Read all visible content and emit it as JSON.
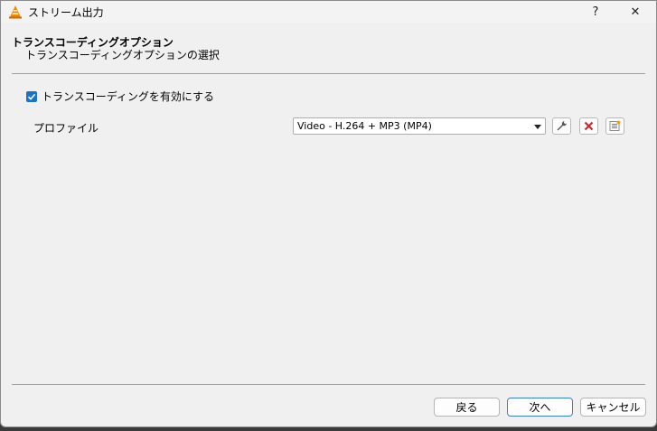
{
  "window": {
    "title": "ストリーム出力",
    "help_label": "?",
    "close_label": "✕"
  },
  "header": {
    "title": "トランスコーディングオプション",
    "subtitle": "トランスコーディングオプションの選択"
  },
  "transcode": {
    "enable_label": "トランスコーディングを有効にする",
    "enabled": true
  },
  "profile": {
    "label": "プロファイル",
    "selected": "Video - H.264 + MP3 (MP4)"
  },
  "buttons": {
    "back": "戻る",
    "next": "次へ",
    "cancel": "キャンセル"
  },
  "colors": {
    "accent": "#1a73c9",
    "delete_red": "#d9232b",
    "vlc_orange": "#f08a00"
  }
}
